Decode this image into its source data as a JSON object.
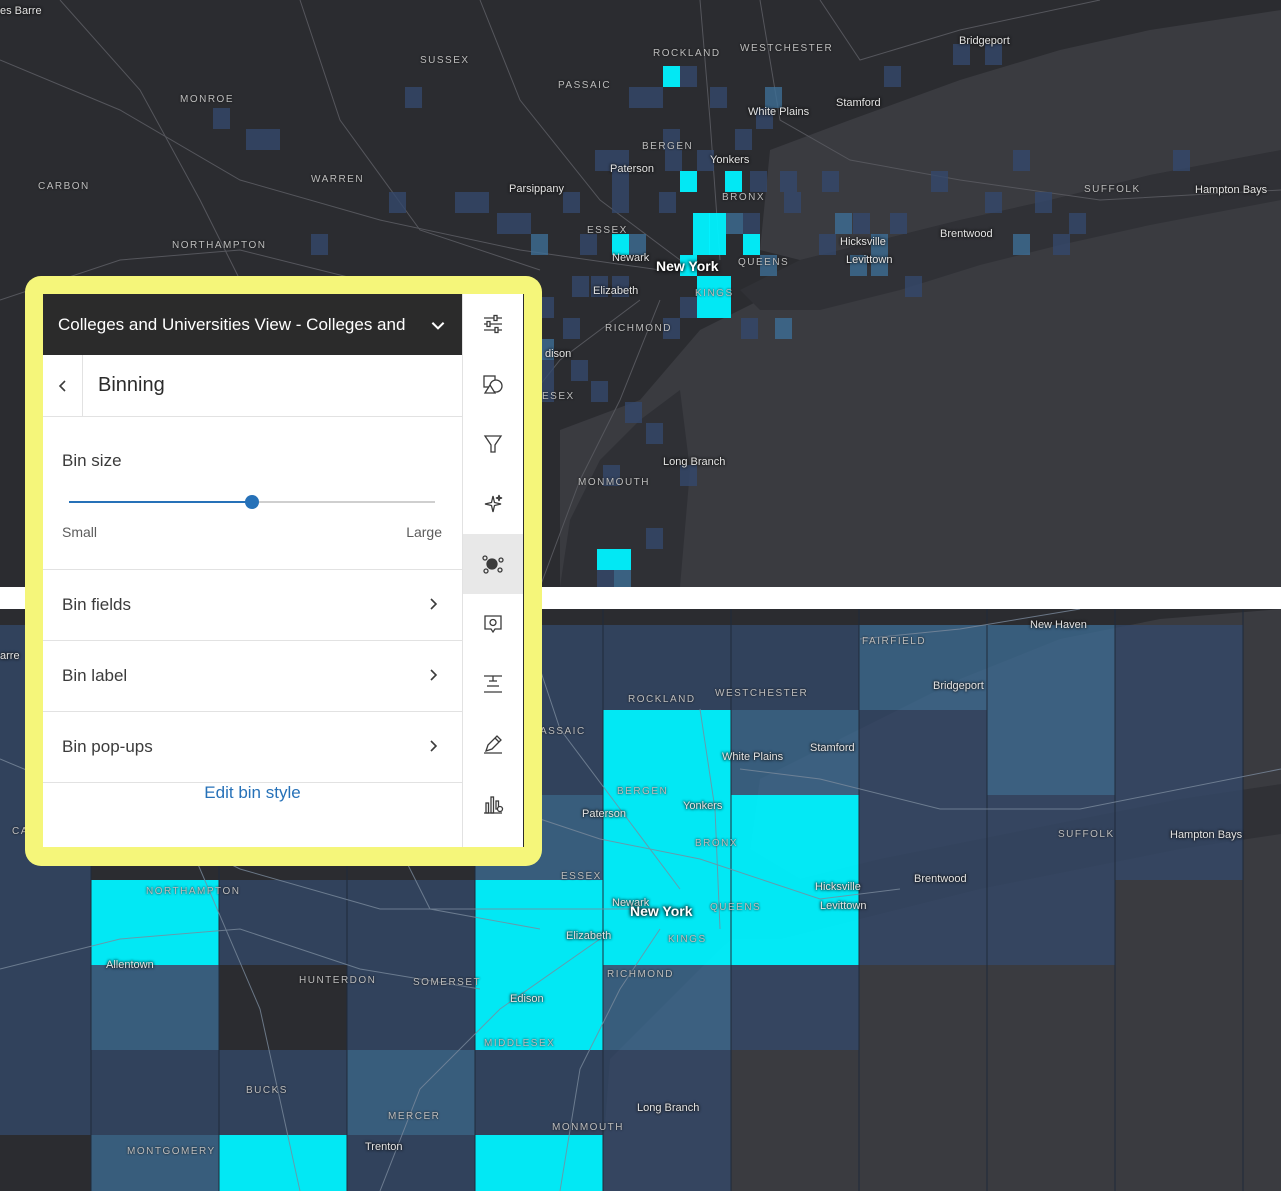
{
  "panel": {
    "layer_title": "Colleges and Universities View - Colleges and",
    "nav_title": "Binning",
    "bin_size_label": "Bin size",
    "bin_size_value": 0.5,
    "slider_min_label": "Small",
    "slider_max_label": "Large",
    "rows": [
      {
        "label": "Bin fields"
      },
      {
        "label": "Bin label"
      },
      {
        "label": "Bin pop-ups"
      }
    ],
    "edit_link": "Edit bin style",
    "toolbar": [
      {
        "icon": "properties-icon"
      },
      {
        "icon": "styles-icon"
      },
      {
        "icon": "filter-icon"
      },
      {
        "icon": "effects-icon"
      },
      {
        "icon": "aggregation-icon",
        "active": true
      },
      {
        "icon": "popups-icon"
      },
      {
        "icon": "labels-icon"
      },
      {
        "icon": "sketch-icon"
      },
      {
        "icon": "charts-icon"
      }
    ]
  },
  "colors": {
    "map_bg": "#2b2c30",
    "land": "#2f3035",
    "water": "#3a3b40",
    "bin_low": "#34496b",
    "bin_mid": "#3d6e95",
    "bin_high": "#00f2ff",
    "highlight_frame": "#f5f67a",
    "accent": "#2671b8"
  },
  "map_top": {
    "labels": [
      {
        "text": "es Barre",
        "cls": "city"
      },
      {
        "text": "SUSSEX",
        "cls": "county"
      },
      {
        "text": "ROCKLAND",
        "cls": "county"
      },
      {
        "text": "WESTCHESTER",
        "cls": "county"
      },
      {
        "text": "Bridgeport",
        "cls": "city"
      },
      {
        "text": "MONROE",
        "cls": "county"
      },
      {
        "text": "PASSAIC",
        "cls": "county"
      },
      {
        "text": "White Plains",
        "cls": "city"
      },
      {
        "text": "Stamford",
        "cls": "city"
      },
      {
        "text": "BERGEN",
        "cls": "county"
      },
      {
        "text": "Yonkers",
        "cls": "city"
      },
      {
        "text": "CARBON",
        "cls": "county"
      },
      {
        "text": "WARREN",
        "cls": "county"
      },
      {
        "text": "Paterson",
        "cls": "city"
      },
      {
        "text": "Parsippany",
        "cls": "city"
      },
      {
        "text": "BRONX",
        "cls": "county"
      },
      {
        "text": "SUFFOLK",
        "cls": "county"
      },
      {
        "text": "Hampton Bays",
        "cls": "city"
      },
      {
        "text": "ESSEX",
        "cls": "county"
      },
      {
        "text": "NORTHAMPTON",
        "cls": "county"
      },
      {
        "text": "Hicksville",
        "cls": "city"
      },
      {
        "text": "Brentwood",
        "cls": "city"
      },
      {
        "text": "Newark",
        "cls": "city"
      },
      {
        "text": "New York",
        "cls": "big"
      },
      {
        "text": "QUEENS",
        "cls": "county"
      },
      {
        "text": "Levittown",
        "cls": "city"
      },
      {
        "text": "Elizabeth",
        "cls": "city"
      },
      {
        "text": "KINGS",
        "cls": "county"
      },
      {
        "text": "RICHMOND",
        "cls": "county"
      },
      {
        "text": "dison",
        "cls": "city"
      },
      {
        "text": "ESEX",
        "cls": "county"
      },
      {
        "text": "Long Branch",
        "cls": "city"
      },
      {
        "text": "MONMOUTH",
        "cls": "county"
      }
    ]
  },
  "map_bottom": {
    "labels": [
      {
        "text": "FAIRFIELD",
        "cls": "county"
      },
      {
        "text": "New Haven",
        "cls": "city"
      },
      {
        "text": "arre",
        "cls": "city"
      },
      {
        "text": "Bridgeport",
        "cls": "city"
      },
      {
        "text": "ROCKLAND",
        "cls": "county"
      },
      {
        "text": "WESTCHESTER",
        "cls": "county"
      },
      {
        "text": "ASSAIC",
        "cls": "county"
      },
      {
        "text": "White Plains",
        "cls": "city"
      },
      {
        "text": "Stamford",
        "cls": "city"
      },
      {
        "text": "BERGEN",
        "cls": "county"
      },
      {
        "text": "Yonkers",
        "cls": "city"
      },
      {
        "text": "Paterson",
        "cls": "city"
      },
      {
        "text": "SUFFOLK",
        "cls": "county"
      },
      {
        "text": "Hampton Bays",
        "cls": "city"
      },
      {
        "text": "BRONX",
        "cls": "county"
      },
      {
        "text": "CA",
        "cls": "county"
      },
      {
        "text": "ESSEX",
        "cls": "county"
      },
      {
        "text": "Brentwood",
        "cls": "city"
      },
      {
        "text": "Hicksville",
        "cls": "city"
      },
      {
        "text": "NORTHAMPTON",
        "cls": "county"
      },
      {
        "text": "Newark",
        "cls": "city"
      },
      {
        "text": "New York",
        "cls": "big"
      },
      {
        "text": "QUEENS",
        "cls": "county"
      },
      {
        "text": "Levittown",
        "cls": "city"
      },
      {
        "text": "Elizabeth",
        "cls": "city"
      },
      {
        "text": "KINGS",
        "cls": "county"
      },
      {
        "text": "Allentown",
        "cls": "city"
      },
      {
        "text": "RICHMOND",
        "cls": "county"
      },
      {
        "text": "HUNTERDON",
        "cls": "county"
      },
      {
        "text": "SOMERSET",
        "cls": "county"
      },
      {
        "text": "Edison",
        "cls": "city"
      },
      {
        "text": "MIDDLESEX",
        "cls": "county"
      },
      {
        "text": "BUCKS",
        "cls": "county"
      },
      {
        "text": "Long Branch",
        "cls": "city"
      },
      {
        "text": "MERCER",
        "cls": "county"
      },
      {
        "text": "MONMOUTH",
        "cls": "county"
      },
      {
        "text": "MONTGOMERY",
        "cls": "county"
      },
      {
        "text": "Trenton",
        "cls": "city"
      }
    ]
  }
}
